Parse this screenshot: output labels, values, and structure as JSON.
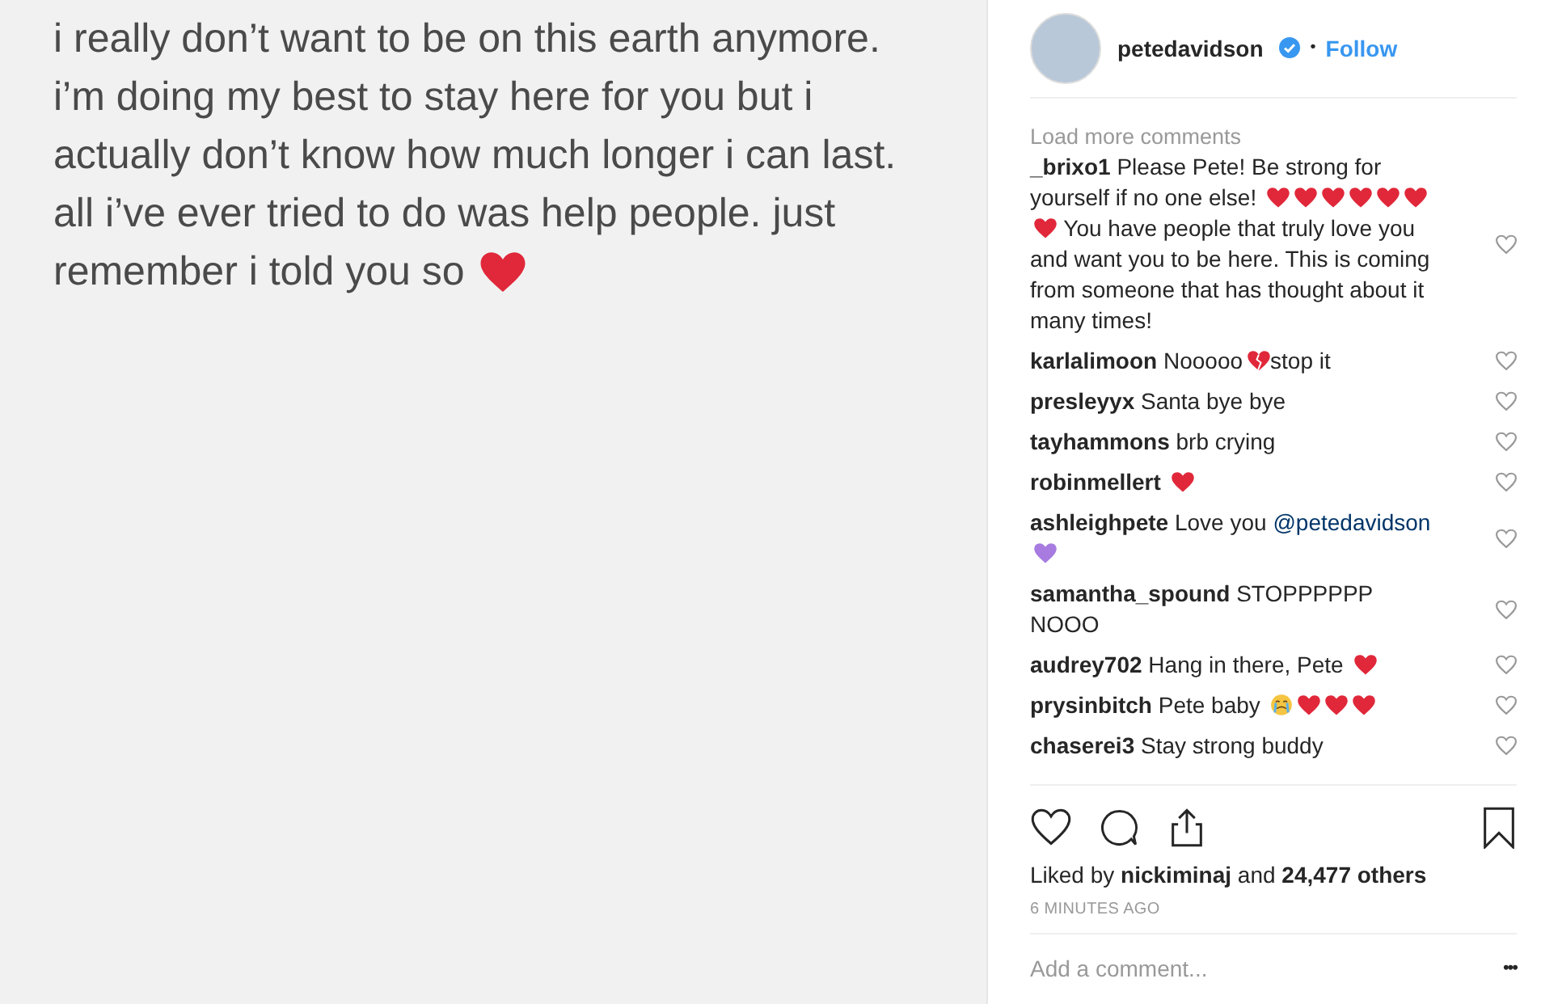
{
  "post": {
    "text": "i really don’t want to be on this earth anymore. i’m doing my best to stay here for you but i actually don’t know how much longer i can last. all i’ve ever tried to do was help people. just remember i told you so",
    "end_emoji": {
      "kind": "heart",
      "color": "#e0283a"
    }
  },
  "header": {
    "username": "petedavidson",
    "verified": true,
    "separator": "•",
    "follow": "Follow"
  },
  "load_more": "Load more comments",
  "comments": [
    {
      "user": "_brixo1",
      "parts": [
        {
          "kind": "text",
          "text": "Please Pete! Be strong for yourself if no one else! "
        },
        {
          "kind": "heart",
          "color": "#e0283a"
        },
        {
          "kind": "heart",
          "color": "#e0283a"
        },
        {
          "kind": "heart",
          "color": "#e0283a"
        },
        {
          "kind": "heart",
          "color": "#e0283a"
        },
        {
          "kind": "heart",
          "color": "#e0283a"
        },
        {
          "kind": "heart",
          "color": "#e0283a"
        },
        {
          "kind": "heart",
          "color": "#e0283a"
        },
        {
          "kind": "text",
          "text": " You have people that truly love you and want you to be here. This is coming from someone that has thought about it many times!"
        }
      ]
    },
    {
      "user": "karlalimoon",
      "parts": [
        {
          "kind": "text",
          "text": "Nooooo"
        },
        {
          "kind": "broken-heart",
          "color": "#e0283a"
        },
        {
          "kind": "text",
          "text": "stop it"
        }
      ]
    },
    {
      "user": "presleyyx",
      "parts": [
        {
          "kind": "text",
          "text": "Santa bye bye"
        }
      ]
    },
    {
      "user": "tayhammons",
      "parts": [
        {
          "kind": "text",
          "text": "brb crying"
        }
      ]
    },
    {
      "user": "robinmellert",
      "parts": [
        {
          "kind": "heart",
          "color": "#e0283a"
        }
      ]
    },
    {
      "user": "ashleighpete",
      "parts": [
        {
          "kind": "text",
          "text": "Love you "
        },
        {
          "kind": "mention",
          "text": "@petedavidson"
        },
        {
          "kind": "heart",
          "color": "#a77be0"
        }
      ]
    },
    {
      "user": "samantha_spound",
      "parts": [
        {
          "kind": "text",
          "text": "STOPPPPPP NOOO"
        }
      ]
    },
    {
      "user": "audrey702",
      "parts": [
        {
          "kind": "text",
          "text": "Hang in there, Pete "
        },
        {
          "kind": "heart",
          "color": "#e0283a"
        }
      ]
    },
    {
      "user": "prysinbitch",
      "parts": [
        {
          "kind": "text",
          "text": "Pete baby "
        },
        {
          "kind": "crying-face"
        },
        {
          "kind": "heart",
          "color": "#e0283a"
        },
        {
          "kind": "heart",
          "color": "#e0283a"
        },
        {
          "kind": "heart",
          "color": "#e0283a"
        }
      ]
    },
    {
      "user": "chaserei3",
      "parts": [
        {
          "kind": "text",
          "text": "Stay strong buddy"
        }
      ]
    }
  ],
  "likes": "Liked by **nickiminaj** and **24,477 others**",
  "time": "6 MINUTES AGO",
  "add_comment": {
    "placeholder": "Add a comment..."
  },
  "more": "•••"
}
